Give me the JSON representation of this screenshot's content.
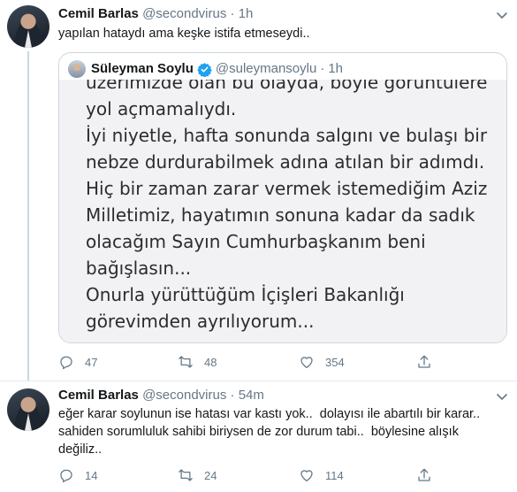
{
  "tweets": [
    {
      "author_name": "Cemil Barlas",
      "handle": "@secondvirus",
      "separator": "·",
      "time": "1h",
      "text": "yapılan hataydı ama keşke istifa etmeseydi..",
      "quote": {
        "author_name": "Süleyman Soylu",
        "handle": "@suleymansoylu",
        "separator": "·",
        "time": "1h",
        "image_lines": [
          "üzerimizde olan bu olayda, böyle görüntülere",
          "yol açmamalıydı.",
          "İyi niyetle, hafta sonunda salgını ve bulaşı bir",
          "nebze durdurabilmek adına atılan bir adımdı.",
          "Hiç bir zaman zarar vermek istemediğim Aziz",
          "Milletimiz, hayatımın sonuna kadar da sadık",
          "olacağım Sayın Cumhurbaşkanım beni",
          "bağışlasın...",
          "Onurla yürüttüğüm İçişleri Bakanlığı",
          "görevimden ayrılıyorum..."
        ]
      },
      "actions": {
        "replies": "47",
        "retweets": "48",
        "likes": "354"
      }
    },
    {
      "author_name": "Cemil Barlas",
      "handle": "@secondvirus",
      "separator": "·",
      "time": "54m",
      "text_lines": [
        "eğer karar soylunun ise hatası var kastı yok..  dolayısı ile abartılı bir karar..",
        "sahiden sorumluluk sahibi biriysen de zor durum tabi..  böylesine alışık",
        "değiliz.."
      ],
      "actions": {
        "replies": "14",
        "retweets": "24",
        "likes": "114"
      }
    }
  ],
  "icons": {
    "reply": "reply-icon",
    "retweet": "retweet-icon",
    "like": "heart-icon",
    "share": "share-icon",
    "more": "chevron-down-icon",
    "verified": "verified-badge-icon"
  },
  "colors": {
    "muted": "#657786",
    "verified": "#1da1f2",
    "border": "#ccd6dd"
  }
}
